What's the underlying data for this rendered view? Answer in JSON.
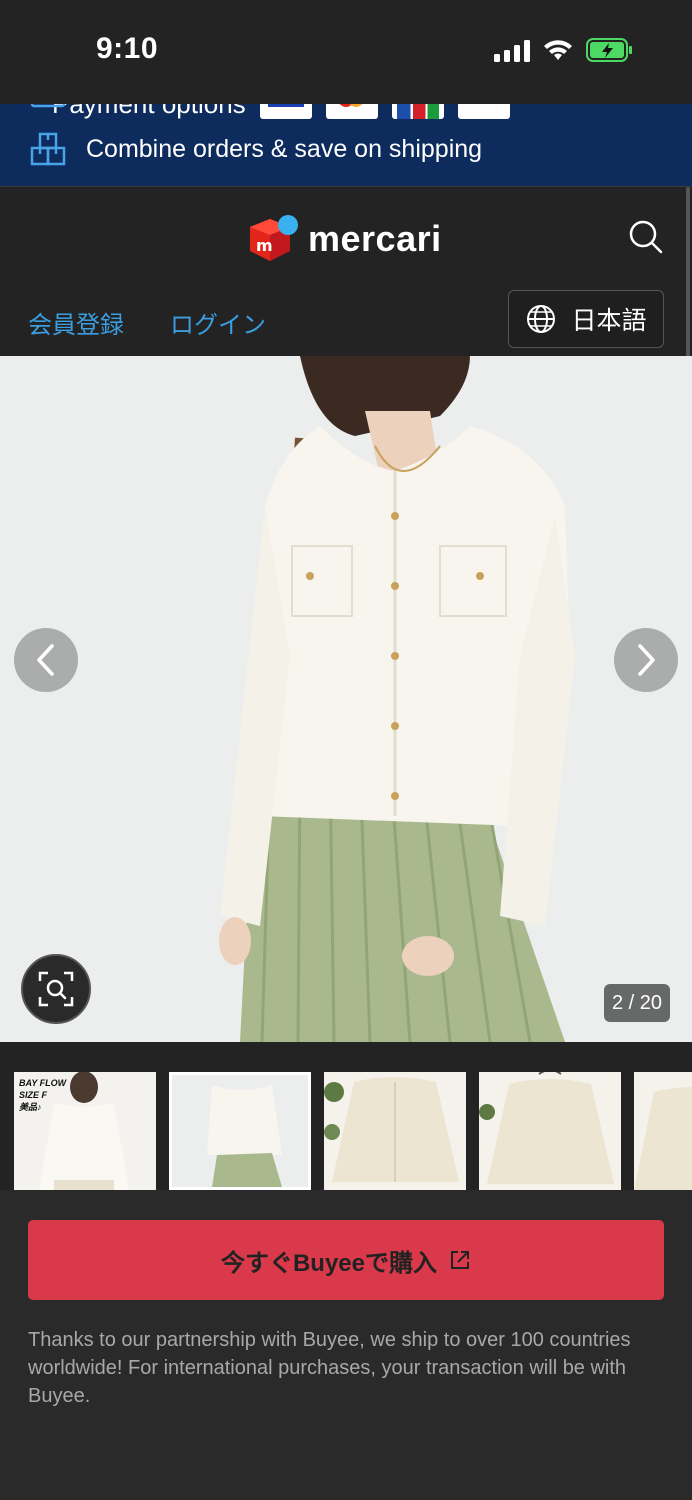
{
  "status_bar": {
    "time": "9:10",
    "icons": [
      "signal-icon",
      "wifi-icon",
      "battery-charging-icon"
    ],
    "battery_color": "#4cd964"
  },
  "promo": {
    "payment_label": "Payment options",
    "card_logos": [
      "visa",
      "mastercard",
      "jcb",
      "card"
    ],
    "combine_label": "Combine orders & save on shipping",
    "background": "#0d2b5c"
  },
  "header": {
    "logo_text": "mercari",
    "logo_colors": [
      "#e1251b",
      "#3ab0f0"
    ],
    "nav": {
      "register": "会員登録",
      "login": "ログイン"
    },
    "language": "日本語",
    "link_color": "#3a9ee0"
  },
  "gallery": {
    "counter": "2 / 20",
    "thumbnails": [
      {
        "caption": "BAY FLOW\nSIZE F\n美品♪"
      },
      {
        "caption": ""
      },
      {
        "caption": ""
      },
      {
        "caption": ""
      },
      {
        "caption": ""
      }
    ],
    "active_index": 1
  },
  "purchase": {
    "button_label": "今すぐBuyeeで購入",
    "button_color": "#d9394a",
    "notice": "Thanks to our partnership with Buyee, we ship to over 100 countries worldwide! For international purchases, your transaction will be with Buyee."
  }
}
